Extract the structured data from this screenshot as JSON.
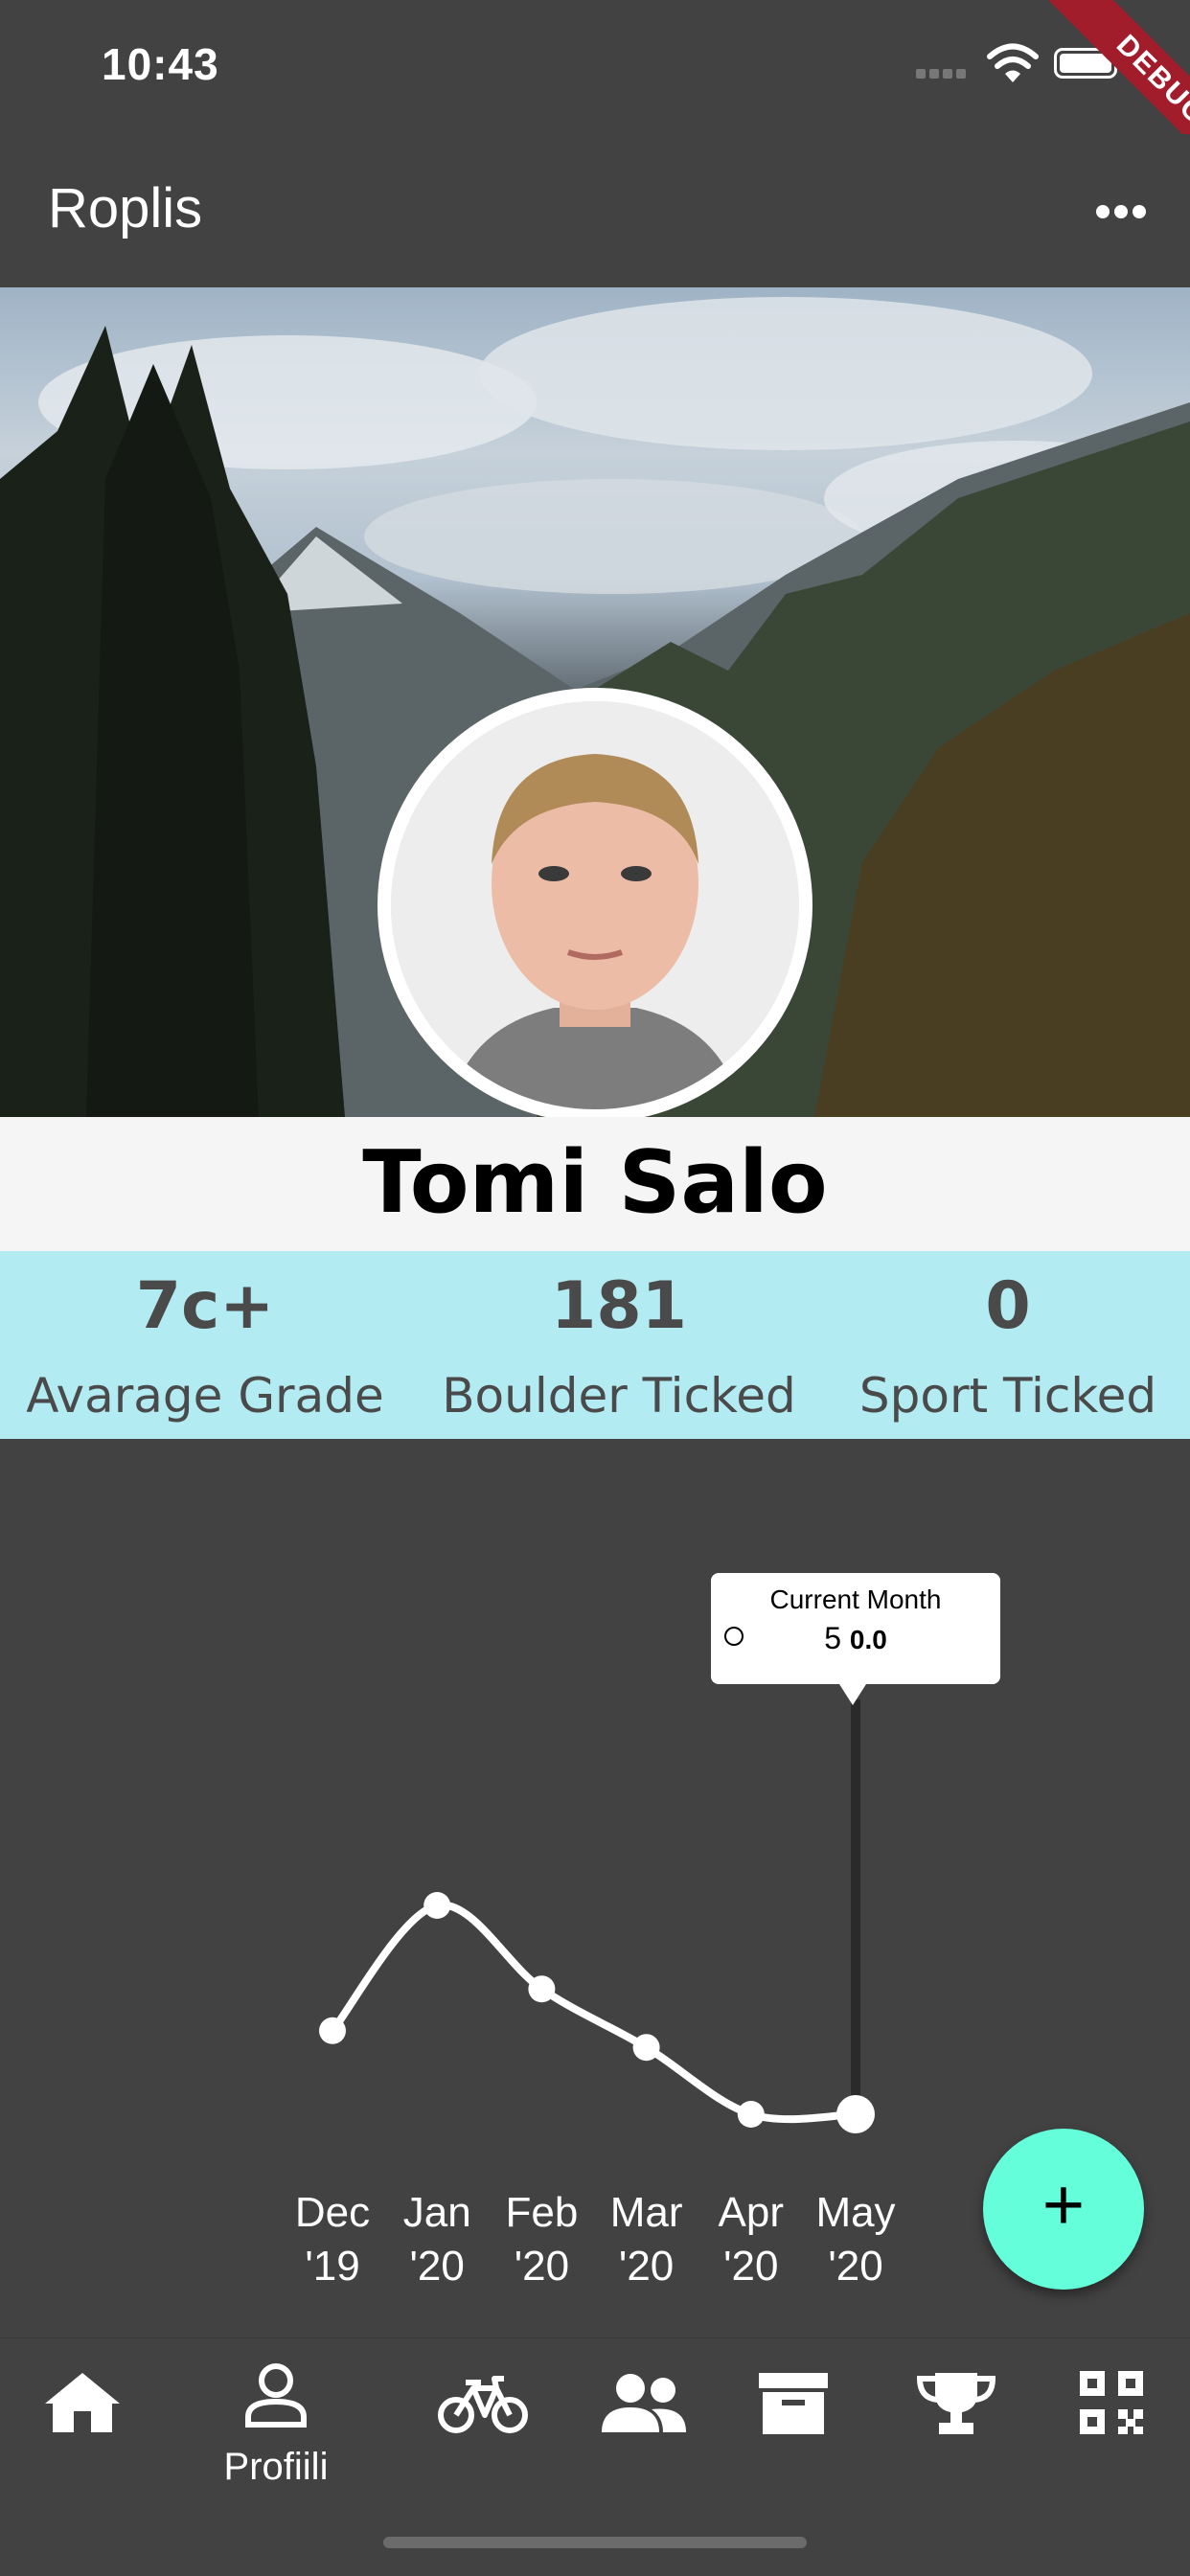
{
  "status_bar": {
    "time": "10:43"
  },
  "debug_banner": {
    "label": "DEBUG"
  },
  "app_bar": {
    "title": "Roplis"
  },
  "profile": {
    "name": "Tomi Salo"
  },
  "stats": [
    {
      "value": "7c+",
      "label": "Avarage Grade"
    },
    {
      "value": "181",
      "label": "Boulder Ticked"
    },
    {
      "value": "0",
      "label": "Sport Ticked"
    }
  ],
  "tooltip": {
    "title": "Current Month",
    "x": "5",
    "y": "0.0"
  },
  "chart_data": {
    "type": "line",
    "x": [
      0,
      1,
      2,
      3,
      4,
      5
    ],
    "values": [
      1.0,
      2.5,
      1.5,
      0.8,
      0.0,
      0.0
    ],
    "tick_labels": [
      {
        "month": "Dec",
        "year": "'19"
      },
      {
        "month": "Jan",
        "year": "'20"
      },
      {
        "month": "Feb",
        "year": "'20"
      },
      {
        "month": "Mar",
        "year": "'20"
      },
      {
        "month": "Apr",
        "year": "'20"
      },
      {
        "month": "May",
        "year": "'20"
      }
    ],
    "ylim": [
      0,
      2.5
    ],
    "grid": false,
    "selected_index": 5,
    "line_color": "#ffffff"
  },
  "fab": {
    "icon": "plus-icon"
  },
  "bottom_nav": {
    "items": [
      {
        "icon": "home-icon",
        "label": ""
      },
      {
        "icon": "person-icon",
        "label": "Profiili"
      },
      {
        "icon": "bicycle-icon",
        "label": ""
      },
      {
        "icon": "group-icon",
        "label": ""
      },
      {
        "icon": "archive-icon",
        "label": ""
      },
      {
        "icon": "trophy-icon",
        "label": ""
      },
      {
        "icon": "qr-code-icon",
        "label": ""
      }
    ]
  },
  "colors": {
    "background": "#424242",
    "stats_band": "#b2ebf2",
    "fab": "#64ffda",
    "debug": "#a11d2c"
  }
}
